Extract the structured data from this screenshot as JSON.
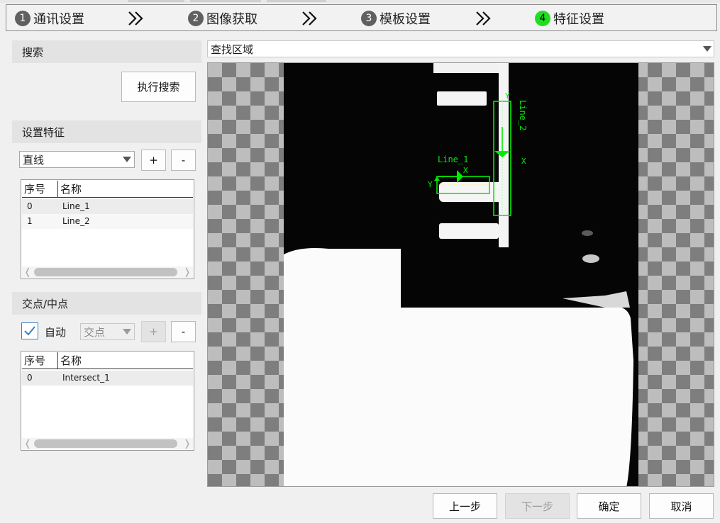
{
  "steps": [
    {
      "num": "1",
      "label": "通讯设置"
    },
    {
      "num": "2",
      "label": "图像获取"
    },
    {
      "num": "3",
      "label": "模板设置"
    },
    {
      "num": "4",
      "label": "特征设置"
    }
  ],
  "search": {
    "header": "搜索",
    "execute_button": "执行搜索"
  },
  "region_select": {
    "value": "查找区域"
  },
  "features": {
    "header": "设置特征",
    "type_select": "直线",
    "add_label": "+",
    "remove_label": "-",
    "table": {
      "col_index": "序号",
      "col_name": "名称",
      "rows": [
        {
          "index": "0",
          "name": "Line_1"
        },
        {
          "index": "1",
          "name": "Line_2"
        }
      ]
    }
  },
  "intersect": {
    "header": "交点/中点",
    "auto_label": "自动",
    "auto_checked": true,
    "mode_select": "交点",
    "add_label": "+",
    "remove_label": "-",
    "table": {
      "col_index": "序号",
      "col_name": "名称",
      "rows": [
        {
          "index": "0",
          "name": "Intersect_1"
        }
      ]
    }
  },
  "overlay": {
    "line1_label": "Line_1",
    "line2_label": "Line_2",
    "axis_x": "X",
    "axis_y": "Y",
    "color": "#00ee00"
  },
  "footer": {
    "prev": "上一步",
    "next": "下一步",
    "ok": "确定",
    "cancel": "取消"
  },
  "colors": {
    "active_step": "#22dd22",
    "inactive_step": "#606060",
    "checkbox_accent": "#3d7fc4"
  }
}
